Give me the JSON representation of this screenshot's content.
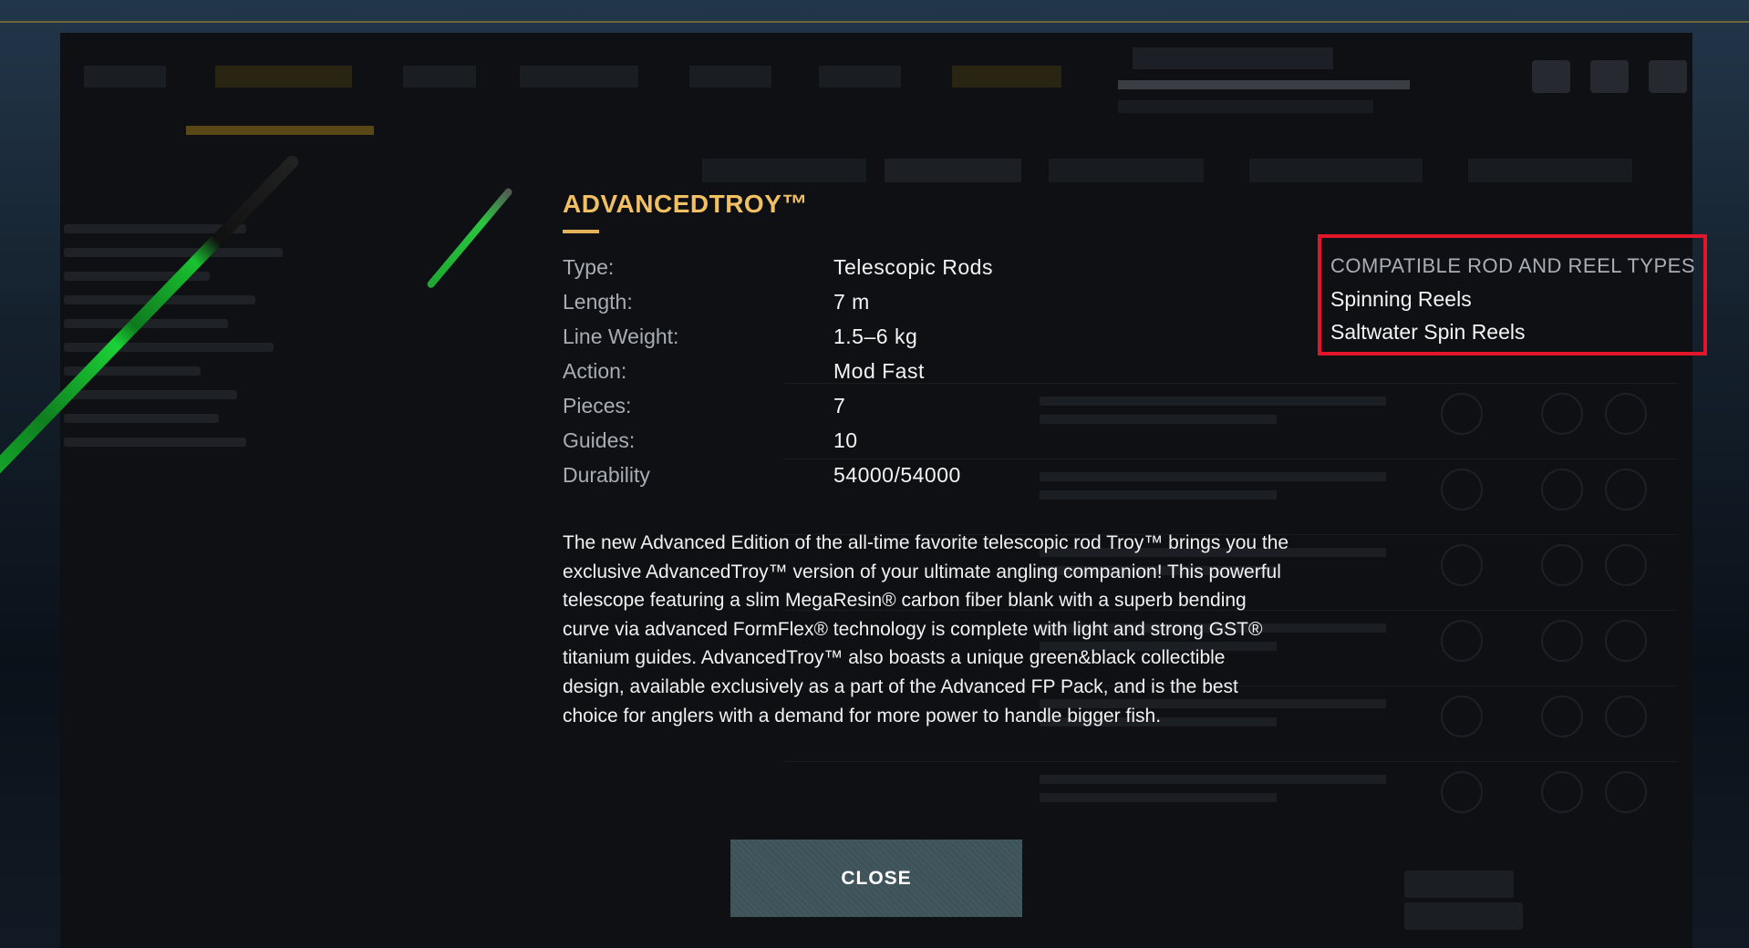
{
  "item": {
    "name": "ADVANCEDTROY™",
    "properties": [
      {
        "label": "Type:",
        "value": "Telescopic Rods"
      },
      {
        "label": "Length:",
        "value": "7 m"
      },
      {
        "label": "Line Weight:",
        "value": "1.5–6 kg"
      },
      {
        "label": "Action:",
        "value": "Mod Fast"
      },
      {
        "label": "Pieces:",
        "value": "7"
      },
      {
        "label": "Guides:",
        "value": "10"
      },
      {
        "label": "Durability",
        "value": "54000/54000"
      }
    ],
    "description": "The new Advanced Edition of the all-time favorite telescopic rod Troy™ brings you the exclusive AdvancedTroy™ version of your ultimate angling companion! This powerful telescope featuring a slim MegaResin® carbon fiber blank with a superb bending curve via advanced FormFlex® technology is complete with light and strong GST® titanium guides. AdvancedTroy™ also boasts a unique green&black collectible design, available exclusively as a part of the Advanced FP Pack, and is the best choice for anglers with a demand for more power to handle bigger fish."
  },
  "compatible": {
    "heading": "COMPATIBLE ROD AND REEL TYPES",
    "items": [
      "Spinning Reels",
      "Saltwater Spin Reels"
    ]
  },
  "close_label": "CLOSE",
  "colors": {
    "title": "#f1c063",
    "highlight_border": "#e2162b",
    "button": "#3d5259",
    "rod_green": "#1bd236"
  }
}
